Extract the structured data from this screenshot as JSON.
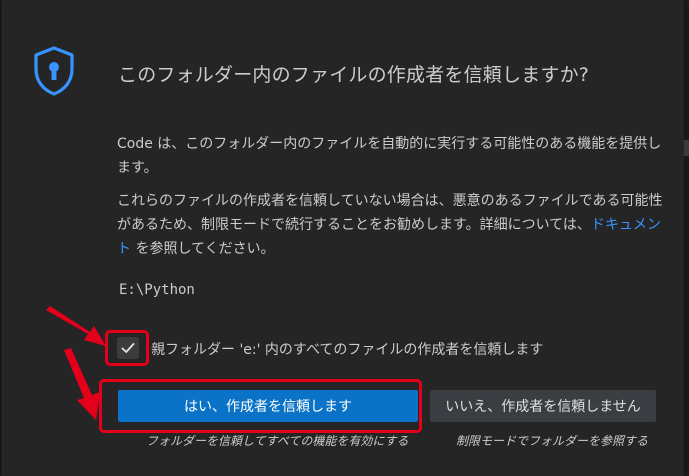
{
  "dialog": {
    "title": "このフォルダー内のファイルの作成者を信頼しますか?",
    "paragraph1": "Code は、このフォルダー内のファイルを自動的に実行する可能性のある機能を提供します。",
    "paragraph2_before": "これらのファイルの作成者を信頼していない場合は、悪意のあるファイルである可能性があるため、制限モードで続行することをお勧めします。詳細については、",
    "paragraph2_link": "ドキュメント",
    "paragraph2_after": " を参照してください。",
    "path": "E:\\Python",
    "checkbox": {
      "label": "親フォルダー 'e:' 内のすべてのファイルの作成者を信頼します",
      "checked": true
    },
    "primary_button": "はい、作成者を信頼します",
    "primary_hint": "フォルダーを信頼してすべての機能を有効にする",
    "secondary_button": "いいえ、作成者を信頼しません",
    "secondary_hint": "制限モードでフォルダーを参照する"
  },
  "icons": {
    "shield": "shield-lock-icon",
    "check": "check-icon",
    "annotation_arrow": "red-arrow-icon"
  },
  "colors": {
    "background": "#252526",
    "text": "#cccccc",
    "primary_button": "#0a73c7",
    "secondary_button": "#3a3d41",
    "link": "#3794ff",
    "shield_accent": "#3794ff",
    "annotation_red": "#e4001b"
  }
}
